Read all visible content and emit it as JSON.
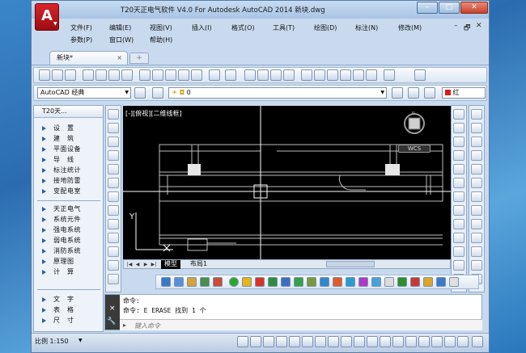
{
  "window": {
    "title": "T20天正电气软件 V4.0 For Autodesk AutoCAD 2014    新块.dwg",
    "app_letter": "A"
  },
  "menu": {
    "row1": [
      "文件(F)",
      "编辑(E)",
      "视图(V)",
      "插入(I)",
      "格式(O)",
      "工具(T)",
      "绘图(D)",
      "标注(N)",
      "修改(M)"
    ],
    "row2": [
      "参数(P)",
      "窗口(W)",
      "帮助(H)"
    ]
  },
  "doc_tab": {
    "label": "新块*",
    "close": "×",
    "new_tab": "+"
  },
  "workspace": {
    "label": "AutoCAD 经典"
  },
  "layer": {
    "label": "0"
  },
  "color": {
    "label": "红"
  },
  "panel": {
    "title": "T20天...",
    "groups": [
      [
        "设　置",
        "建　筑",
        "平面设备",
        "导　线",
        "标注统计",
        "接地防雷",
        "变配电室"
      ],
      [
        "天正电气",
        "系统元件",
        "强电系统",
        "弱电系统",
        "消防系统",
        "原理图",
        "计　算"
      ],
      [
        "文　字",
        "表　格",
        "尺　寸"
      ]
    ]
  },
  "canvas": {
    "view_label": "[-][俯视][二维线框]",
    "wcs": "WCS",
    "y_axis": "Y",
    "background": "#000000"
  },
  "layout_tabs": {
    "model": "模型",
    "layout1": "布局1",
    "nav": [
      "|◀",
      "◀",
      "▶",
      "▶|"
    ]
  },
  "command": {
    "history": [
      "命令:",
      "命令: E ERASE 找到 1 个"
    ],
    "prompt_placeholder": "键入命令",
    "close": "×",
    "wrench": "🔧"
  },
  "status": {
    "scale": "比例 1:150"
  }
}
